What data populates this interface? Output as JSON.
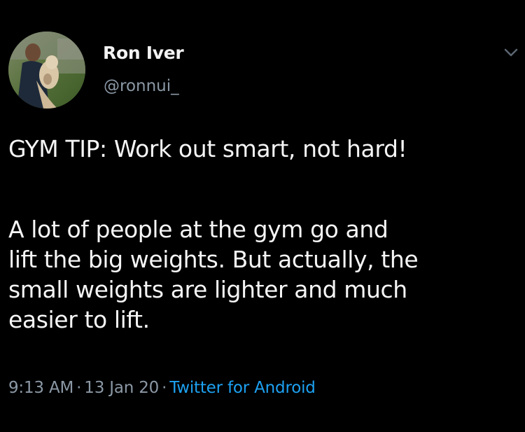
{
  "tweet": {
    "author": {
      "display_name": "Ron Iver",
      "handle": "@ronnui_"
    },
    "headline": "GYM TIP: Work out smart, not hard!",
    "body_lines": [
      "A lot of people at the gym go and",
      "lift the big weights. But actually, the",
      "small weights are lighter and much",
      "easier to lift."
    ],
    "meta": {
      "time": "9:13 AM",
      "separator": "·",
      "date": "13 Jan 20",
      "source": "Twitter for Android"
    }
  },
  "icons": {
    "menu": "chevron-down-icon"
  },
  "colors": {
    "background": "#000000",
    "text": "#f5f5f5",
    "secondary": "#8b98a5",
    "link": "#1da1f2"
  }
}
